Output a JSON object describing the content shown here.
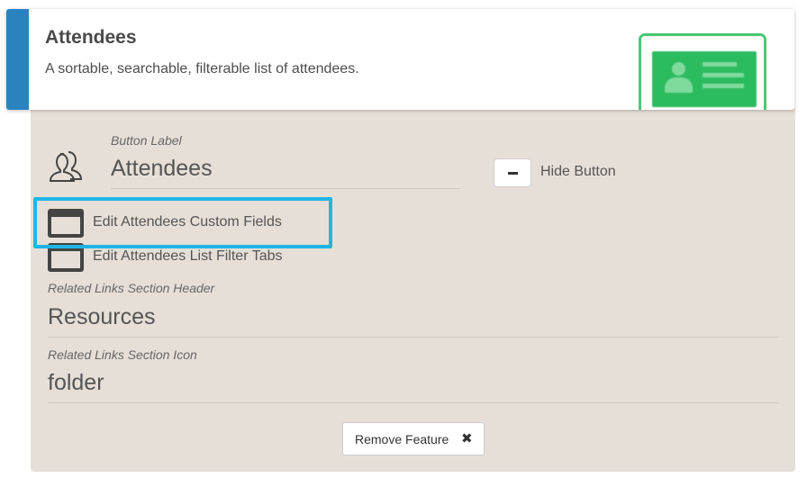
{
  "feature": {
    "title": "Attendees",
    "description": "A sortable, searchable, filterable list of attendees.",
    "icon": "attendee-card-icon"
  },
  "button_section": {
    "label_caption": "Button Label",
    "label_value": "Attendees",
    "icon": "users-icon",
    "hide_button_label": "Hide Button",
    "hide_button_icon": "minus-icon"
  },
  "links": [
    {
      "label": "Edit Attendees Custom Fields",
      "icon": "window-icon",
      "highlighted": true
    },
    {
      "label": "Edit Attendees List Filter Tabs",
      "icon": "window-icon",
      "highlighted": false
    }
  ],
  "related_links": {
    "header_caption": "Related Links Section Header",
    "header_value": "Resources",
    "icon_caption": "Related Links Section Icon",
    "icon_value": "folder"
  },
  "actions": {
    "remove_label": "Remove Feature",
    "remove_icon": "✖"
  },
  "colors": {
    "accent": "#2a83c1",
    "highlight": "#1fb5e8",
    "icon_green": "#2dbb5f",
    "panel": "#e6dfd8"
  }
}
